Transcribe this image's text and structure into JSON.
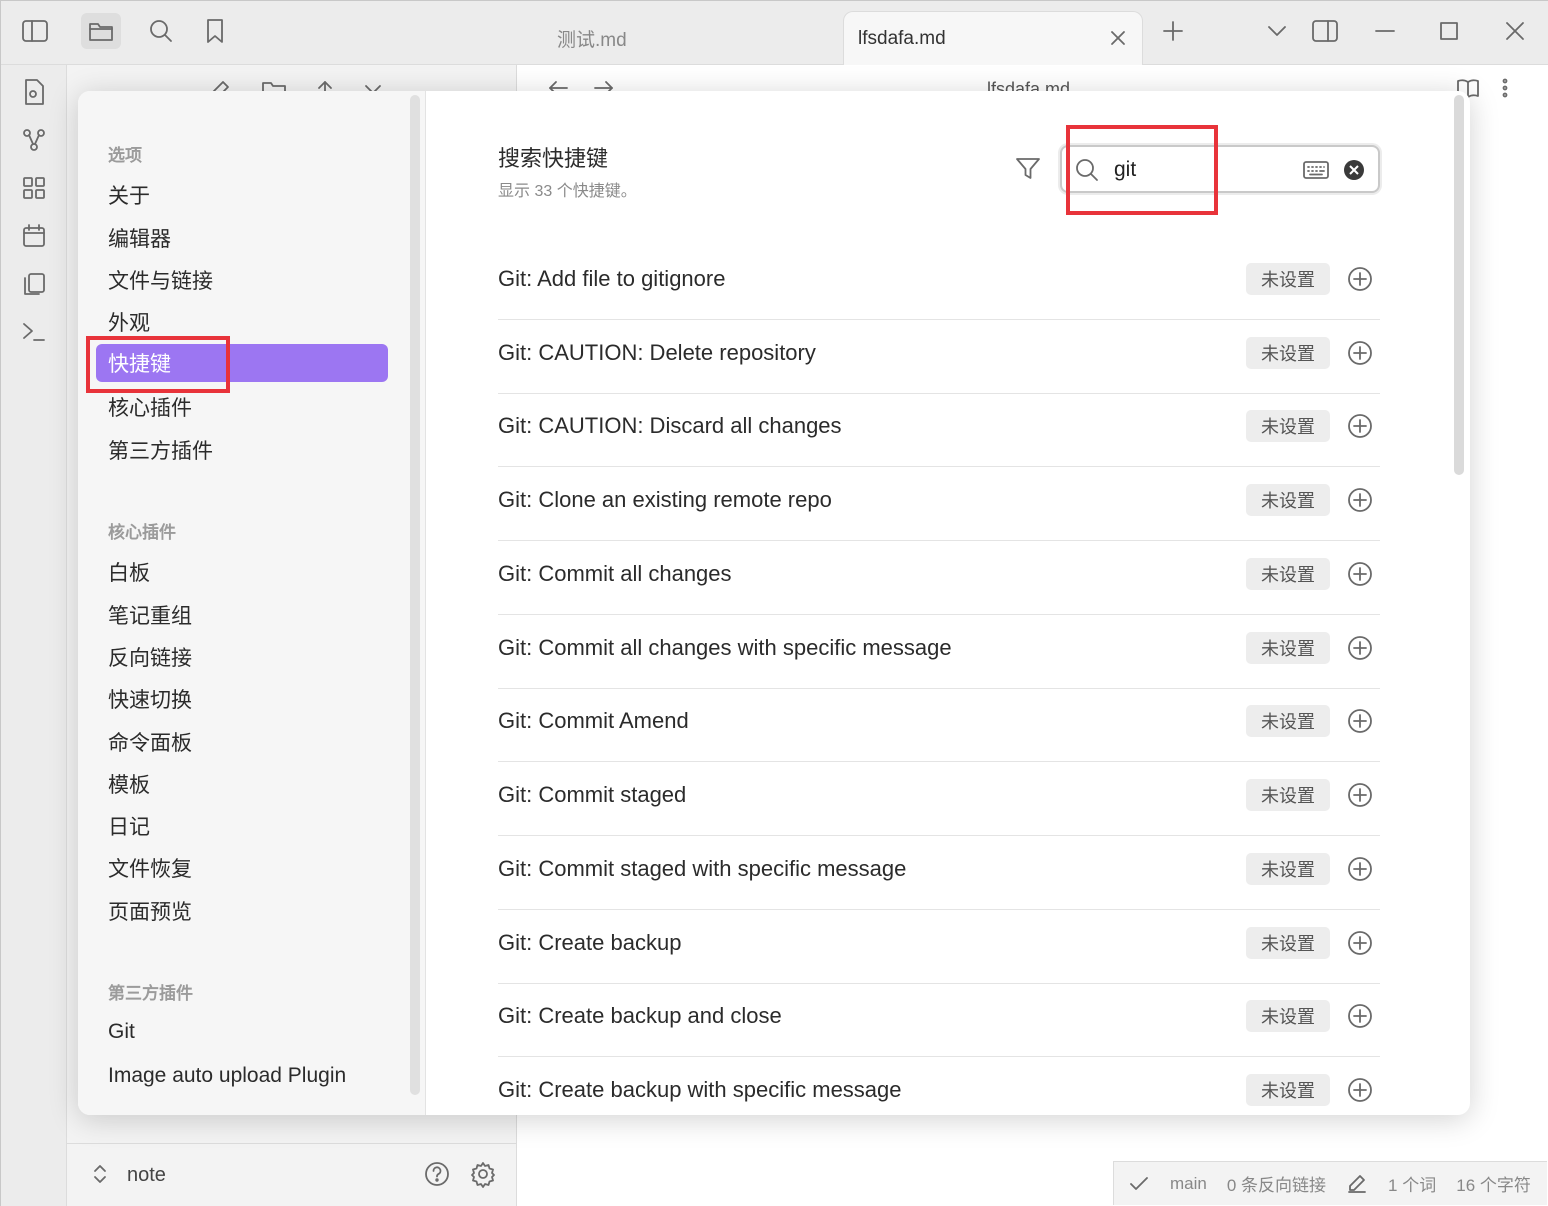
{
  "tabs": [
    {
      "label": "测试.md",
      "active": false
    },
    {
      "label": "lfsdafa.md",
      "active": true
    }
  ],
  "editor_title": "lfsdafa.md",
  "vault_name": "note",
  "status_bar": {
    "branch": "main",
    "backlinks": "0 条反向链接",
    "words": "1 个词",
    "chars": "16 个字符"
  },
  "settings": {
    "sidebar": {
      "sections": [
        {
          "heading": "选项",
          "items": [
            {
              "label": "关于"
            },
            {
              "label": "编辑器"
            },
            {
              "label": "文件与链接"
            },
            {
              "label": "外观"
            },
            {
              "label": "快捷键",
              "active": true
            },
            {
              "label": "核心插件"
            },
            {
              "label": "第三方插件"
            }
          ]
        },
        {
          "heading": "核心插件",
          "items": [
            {
              "label": "白板"
            },
            {
              "label": "笔记重组"
            },
            {
              "label": "反向链接"
            },
            {
              "label": "快速切换"
            },
            {
              "label": "命令面板"
            },
            {
              "label": "模板"
            },
            {
              "label": "日记"
            },
            {
              "label": "文件恢复"
            },
            {
              "label": "页面预览"
            }
          ]
        },
        {
          "heading": "第三方插件",
          "items": [
            {
              "label": "Git"
            },
            {
              "label": "Image auto upload Plugin"
            }
          ]
        }
      ]
    },
    "hotkeys": {
      "title": "搜索快捷键",
      "subtitle": "显示 33 个快捷键。",
      "search_value": "git",
      "not_set_label": "未设置",
      "items": [
        "Git: Add file to gitignore",
        "Git: CAUTION: Delete repository",
        "Git: CAUTION: Discard all changes",
        "Git: Clone an existing remote repo",
        "Git: Commit all changes",
        "Git: Commit all changes with specific message",
        "Git: Commit Amend",
        "Git: Commit staged",
        "Git: Commit staged with specific message",
        "Git: Create backup",
        "Git: Create backup and close",
        "Git: Create backup with specific message"
      ]
    }
  },
  "colors": {
    "accent": "#9c76f2",
    "highlight_box": "#e8333a"
  }
}
